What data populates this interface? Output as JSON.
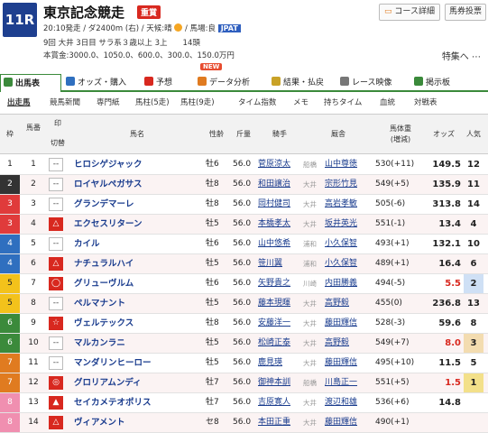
{
  "race": {
    "number": "11R",
    "name": "東京記念競走",
    "grade": "重賞",
    "meta1_a": "20:10発走 / ダ2400m (右) / 天候:晴",
    "meta1_b": " / 馬場:良",
    "jpat": "JPAT",
    "meta2": "9回 大井 3日目 サラ系３歳以上 3上　　14頭",
    "meta3": "本賞金:3000.0、1050.0、600.0、300.0、150.0万円",
    "btn_course": "コース詳細",
    "btn_baken": "馬券投票",
    "special": "特集へ"
  },
  "tabs": [
    {
      "label": "出馬表",
      "color": "#3b8a3b"
    },
    {
      "label": "オッズ・購入",
      "color": "#2f6fbf"
    },
    {
      "label": "予想",
      "color": "#d8281f"
    },
    {
      "label": "データ分析",
      "color": "#e07b20"
    },
    {
      "label": "結果・払戻",
      "color": "#c9a227"
    },
    {
      "label": "レース映像",
      "color": "#777"
    },
    {
      "label": "掲示板",
      "color": "#3b8a3b"
    }
  ],
  "new_badge": "NEW",
  "subtabs": [
    "出走馬",
    "競馬新聞",
    "専門紙",
    "馬柱(5走)",
    "馬柱(9走)",
    "タイム指数",
    "メモ",
    "持ちタイム",
    "血統",
    "対戦表"
  ],
  "headers": {
    "waku": "枠",
    "uma": "馬番",
    "mark1": "印",
    "mark2": "切替",
    "horse": "馬名",
    "sex": "性齢",
    "wt": "斤量",
    "jockey": "騎手",
    "trainer": "厩舎",
    "bw1": "馬体重",
    "bw2": "(増減)",
    "odds": "オッズ",
    "pop": "人気"
  },
  "rows": [
    {
      "waku": "1",
      "wc": "#ffffff",
      "wt": "#222",
      "uma": "1",
      "mark": "--",
      "hl": false,
      "horse": "ヒロシゲジャック",
      "sex": "牡6",
      "wt_": "56.0",
      "jockey": "菅原涼太",
      "area": "船橋",
      "trainer": "山中尊徳",
      "bw": "530(+11)",
      "odds": "149.5",
      "oc": "#222",
      "pop": "12",
      "pc": ""
    },
    {
      "waku": "2",
      "wc": "#333333",
      "wt": "#fff",
      "uma": "2",
      "mark": "--",
      "hl": false,
      "horse": "ロイヤルペガサス",
      "sex": "牡8",
      "wt_": "56.0",
      "jockey": "和田譲治",
      "area": "大井",
      "trainer": "宗形竹見",
      "bw": "549(+5)",
      "odds": "135.9",
      "oc": "#222",
      "pop": "11",
      "pc": ""
    },
    {
      "waku": "3",
      "wc": "#e03b3b",
      "wt": "#fff",
      "uma": "3",
      "mark": "--",
      "hl": false,
      "horse": "グランデマーレ",
      "sex": "牡8",
      "wt_": "56.0",
      "jockey": "岡村健司",
      "area": "大井",
      "trainer": "高岩孝敏",
      "bw": "505(-6)",
      "odds": "313.8",
      "oc": "#222",
      "pop": "14",
      "pc": ""
    },
    {
      "waku": "3",
      "wc": "#e03b3b",
      "wt": "#fff",
      "uma": "4",
      "mark": "△",
      "hl": true,
      "horse": "エクセスリターン",
      "sex": "牡5",
      "wt_": "56.0",
      "jockey": "本橋孝太",
      "area": "大井",
      "trainer": "坂井英光",
      "bw": "551(-1)",
      "odds": "13.4",
      "oc": "#222",
      "pop": "4",
      "pc": ""
    },
    {
      "waku": "4",
      "wc": "#2f6fbf",
      "wt": "#fff",
      "uma": "5",
      "mark": "--",
      "hl": false,
      "horse": "カイル",
      "sex": "牡6",
      "wt_": "56.0",
      "jockey": "山中悠希",
      "area": "浦和",
      "trainer": "小久保智",
      "bw": "493(+1)",
      "odds": "132.1",
      "oc": "#222",
      "pop": "10",
      "pc": ""
    },
    {
      "waku": "4",
      "wc": "#2f6fbf",
      "wt": "#fff",
      "uma": "6",
      "mark": "△",
      "hl": true,
      "horse": "ナチュラルハイ",
      "sex": "牡5",
      "wt_": "56.0",
      "jockey": "笹川翼",
      "area": "浦和",
      "trainer": "小久保智",
      "bw": "489(+1)",
      "odds": "16.4",
      "oc": "#222",
      "pop": "6",
      "pc": ""
    },
    {
      "waku": "5",
      "wc": "#f3c21b",
      "wt": "#222",
      "uma": "7",
      "mark": "◯",
      "hl": true,
      "horse": "グリューヴルム",
      "sex": "牡6",
      "wt_": "56.0",
      "jockey": "矢野貴之",
      "area": "川崎",
      "trainer": "内田勝義",
      "bw": "494(-5)",
      "odds": "5.5",
      "oc": "#d8281f",
      "pop": "2",
      "pc": "#cfe0f5"
    },
    {
      "waku": "5",
      "wc": "#f3c21b",
      "wt": "#222",
      "uma": "8",
      "mark": "--",
      "hl": false,
      "horse": "ペルマナント",
      "sex": "牡5",
      "wt_": "56.0",
      "jockey": "藤本現暉",
      "area": "大井",
      "trainer": "高野毅",
      "bw": "455(0)",
      "odds": "236.8",
      "oc": "#222",
      "pop": "13",
      "pc": ""
    },
    {
      "waku": "6",
      "wc": "#3b8a3b",
      "wt": "#fff",
      "uma": "9",
      "mark": "☆",
      "hl": true,
      "horse": "ヴェルテックス",
      "sex": "牡8",
      "wt_": "56.0",
      "jockey": "安藤洋一",
      "area": "大井",
      "trainer": "藤田輝信",
      "bw": "528(-3)",
      "odds": "59.6",
      "oc": "#222",
      "pop": "8",
      "pc": ""
    },
    {
      "waku": "6",
      "wc": "#3b8a3b",
      "wt": "#fff",
      "uma": "10",
      "mark": "--",
      "hl": false,
      "horse": "マルカンラニ",
      "sex": "牡5",
      "wt_": "56.0",
      "jockey": "松崎正泰",
      "area": "大井",
      "trainer": "高野毅",
      "bw": "549(+7)",
      "odds": "8.0",
      "oc": "#d8281f",
      "pop": "3",
      "pc": "#f3dcb0"
    },
    {
      "waku": "7",
      "wc": "#e07b20",
      "wt": "#fff",
      "uma": "11",
      "mark": "--",
      "hl": false,
      "horse": "マンダリンヒーロー",
      "sex": "牡5",
      "wt_": "56.0",
      "jockey": "鹿見瑛",
      "area": "大井",
      "trainer": "藤田輝信",
      "bw": "495(+10)",
      "odds": "11.5",
      "oc": "#222",
      "pop": "5",
      "pc": ""
    },
    {
      "waku": "7",
      "wc": "#e07b20",
      "wt": "#fff",
      "uma": "12",
      "mark": "◎",
      "hl": true,
      "horse": "グロリアムンディ",
      "sex": "牡7",
      "wt_": "56.0",
      "jockey": "御神本訓",
      "area": "船橋",
      "trainer": "川島正一",
      "bw": "551(+5)",
      "odds": "1.5",
      "oc": "#d8281f",
      "pop": "1",
      "pc": "#f3e08a"
    },
    {
      "waku": "8",
      "wc": "#f08fb0",
      "wt": "#fff",
      "uma": "13",
      "mark": "▲",
      "hl": true,
      "horse": "セイカメテオポリス",
      "sex": "牡7",
      "wt_": "56.0",
      "jockey": "吉原寛人",
      "area": "大井",
      "trainer": "渡辺和雄",
      "bw": "536(+6)",
      "odds": "14.8",
      "oc": "#222",
      "pop": "",
      "pc": ""
    },
    {
      "waku": "8",
      "wc": "#f08fb0",
      "wt": "#fff",
      "uma": "14",
      "mark": "△",
      "hl": true,
      "horse": "ヴィアメント",
      "sex": "セ8",
      "wt_": "56.0",
      "jockey": "本田正重",
      "area": "大井",
      "trainer": "藤田輝信",
      "bw": "490(+1)",
      "odds": "",
      "oc": "#222",
      "pop": "",
      "pc": ""
    }
  ]
}
